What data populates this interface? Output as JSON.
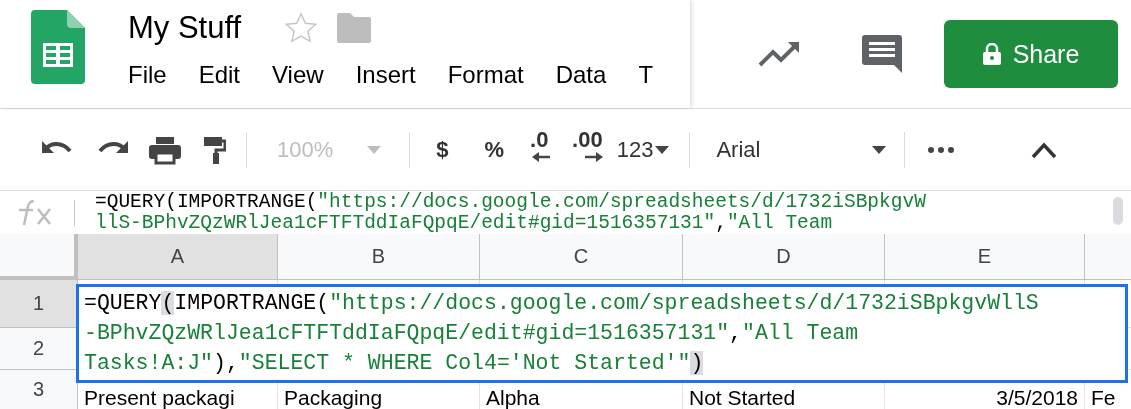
{
  "app": {
    "title": "My Stuff",
    "starred": false
  },
  "menu": [
    "File",
    "Edit",
    "View",
    "Insert",
    "Format",
    "Data",
    "T"
  ],
  "share": {
    "label": "Share"
  },
  "toolbar": {
    "zoom": "100%",
    "zoom_disabled": true,
    "currency": "$",
    "percent": "%",
    "decimal_less": ".0",
    "decimal_more": ".00",
    "number_format": "123",
    "font": "Arial"
  },
  "formula_bar": {
    "lines": [
      [
        {
          "text": "=QUERY(IMPORTRANGE(",
          "kind": "code"
        },
        {
          "text": "\"https://docs.google.com/spreadsheets/d/1732iSBpkgvW",
          "kind": "string"
        }
      ],
      [
        {
          "text": "llS-BPhvZQzWRlJea1cFTFTddIaFQpqE/edit#gid=1516357131\"",
          "kind": "string"
        },
        {
          "text": ",",
          "kind": "code"
        },
        {
          "text": "\"All Team",
          "kind": "string"
        }
      ]
    ]
  },
  "grid": {
    "columns": [
      {
        "label": "A",
        "selected": true
      },
      {
        "label": "B",
        "selected": false
      },
      {
        "label": "C",
        "selected": false
      },
      {
        "label": "D",
        "selected": false
      },
      {
        "label": "E",
        "selected": false
      }
    ],
    "rows": [
      {
        "label": "1",
        "selected": true,
        "cells": []
      },
      {
        "label": "2",
        "selected": false,
        "cells": []
      },
      {
        "label": "3",
        "selected": false,
        "cells": [
          "Present packagi",
          "Packaging",
          "Alpha",
          "Not Started",
          "3/5/2018",
          "Fe"
        ]
      }
    ]
  },
  "cell_editor": {
    "lines": [
      [
        {
          "text": "=QUERY",
          "kind": "code",
          "highlight": false
        },
        {
          "text": "(",
          "kind": "code",
          "highlight": true
        },
        {
          "text": "IMPORTRANGE(",
          "kind": "code",
          "highlight": false
        },
        {
          "text": "\"https://docs.google.com/spreadsheets/d/1732iSBpkgvWllS",
          "kind": "string",
          "highlight": false
        }
      ],
      [
        {
          "text": "-BPhvZQzWRlJea1cFTFTddIaFQpqE/edit#gid=1516357131\"",
          "kind": "string",
          "highlight": false
        },
        {
          "text": ",",
          "kind": "code",
          "highlight": false
        },
        {
          "text": "\"All Team",
          "kind": "string",
          "highlight": false
        }
      ],
      [
        {
          "text": "Tasks!A:J\"",
          "kind": "string",
          "highlight": false
        },
        {
          "text": "),",
          "kind": "code",
          "highlight": false
        },
        {
          "text": "\"SELECT * WHERE Col4='Not Started'\"",
          "kind": "string",
          "highlight": false
        },
        {
          "text": ")",
          "kind": "code",
          "highlight": true
        }
      ]
    ]
  }
}
